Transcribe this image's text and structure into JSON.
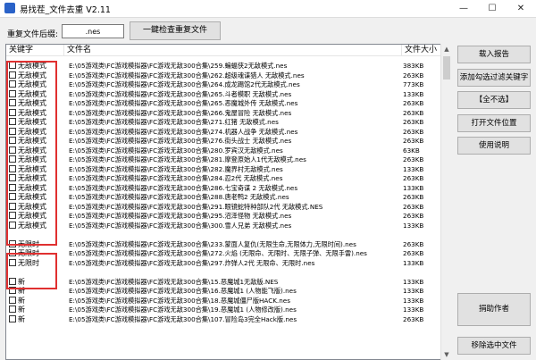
{
  "window": {
    "title": "易找茬_文件去重 V2.11",
    "minimize_glyph": "—",
    "maximize_glyph": "☐",
    "close_glyph": "✕"
  },
  "ext": {
    "label": "重复文件后缀:",
    "value": ".nes"
  },
  "check_button": "一鍵检查重复文件",
  "columns": {
    "keyword": "关键字",
    "filename": "文件名",
    "size": "文件大小"
  },
  "rows": [
    {
      "kw": "无敌模式",
      "file": "E:\\05游戏类\\FC游戏模拟器\\FC游戏无敌300合集\\259.蝙蝠侠2无敌模式.nes",
      "size": "383KB"
    },
    {
      "kw": "无敌模式",
      "file": "E:\\05游戏类\\FC游戏模拟器\\FC游戏无敌300合集\\262.超级魂谍猎人 无敌模式.nes",
      "size": "263KB"
    },
    {
      "kw": "无敌模式",
      "file": "E:\\05游戏类\\FC游戏模拟器\\FC游戏无敌300合集\\264.成龙踢馆2代无敌模式.nes",
      "size": "773KB"
    },
    {
      "kw": "无敌模式",
      "file": "E:\\05游戏类\\FC游戏模拟器\\FC游戏无敌300合集\\265.斗者模职 无敌模式.nes",
      "size": "133KB"
    },
    {
      "kw": "无敌模式",
      "file": "E:\\05游戏类\\FC游戏模拟器\\FC游戏无敌300合集\\265.恶魔城外传 无敌模式.nes",
      "size": "263KB"
    },
    {
      "kw": "无敌模式",
      "file": "E:\\05游戏类\\FC游戏模拟器\\FC游戏无敌300合集\\266.鬼屋冒险 无敌模式.nes",
      "size": "263KB"
    },
    {
      "kw": "无敌模式",
      "file": "E:\\05游戏类\\FC游戏模拟器\\FC游戏无敌300合集\\271.红猪 无敌模式.nes",
      "size": "263KB"
    },
    {
      "kw": "无敌模式",
      "file": "E:\\05游戏类\\FC游戏模拟器\\FC游戏无敌300合集\\274.机器人战争 无敌模式.nes",
      "size": "263KB"
    },
    {
      "kw": "无敌模式",
      "file": "E:\\05游戏类\\FC游戏模拟器\\FC游戏无敌300合集\\276.街头战士 无敌模式.nes",
      "size": "263KB"
    },
    {
      "kw": "无敌模式",
      "file": "E:\\05游戏类\\FC游戏模拟器\\FC游戏无敌300合集\\280.罗宾汉无敌模式.nes",
      "size": "63KB"
    },
    {
      "kw": "无敌模式",
      "file": "E:\\05游戏类\\FC游戏模拟器\\FC游戏无敌300合集\\281.摩登原始人1代无敌模式.nes",
      "size": "263KB"
    },
    {
      "kw": "无敌模式",
      "file": "E:\\05游戏类\\FC游戏模拟器\\FC游戏无敌300合集\\282.魔界村无敌模式.nes",
      "size": "133KB"
    },
    {
      "kw": "无敌模式",
      "file": "E:\\05游戏类\\FC游戏模拟器\\FC游戏无敌300合集\\284.忍2代 无敌模式.nes",
      "size": "263KB"
    },
    {
      "kw": "无敌模式",
      "file": "E:\\05游戏类\\FC游戏模拟器\\FC游戏无敌300合集\\286.七宝奇谋 2 无敌模式.nes",
      "size": "133KB"
    },
    {
      "kw": "无敌模式",
      "file": "E:\\05游戏类\\FC游戏模拟器\\FC游戏无敌300合集\\288.唐老鸭2 无敌模式.nes",
      "size": "263KB"
    },
    {
      "kw": "无敌模式",
      "file": "E:\\05游戏类\\FC游戏模拟器\\FC游戏无敌300合集\\291.眼镜蛇特种部队2代 无敌模式.NES",
      "size": "263KB"
    },
    {
      "kw": "无敌模式",
      "file": "E:\\05游戏类\\FC游戏模拟器\\FC游戏无敌300合集\\295.沼泽怪物 无敌模式.nes",
      "size": "263KB"
    },
    {
      "kw": "无敌模式",
      "file": "E:\\05游戏类\\FC游戏模拟器\\FC游戏无敌300合集\\300.雪人兄弟 无敌模式.nes",
      "size": "133KB"
    },
    {
      "kw": "",
      "file": "",
      "size": ""
    },
    {
      "kw": "无限时",
      "file": "E:\\05游戏类\\FC游戏模拟器\\FC游戏无敌300合集\\233.蒙面人复仇(无限生命,无限体力,无限时间).nes",
      "size": "263KB"
    },
    {
      "kw": "无限时",
      "file": "E:\\05游戏类\\FC游戏模拟器\\FC游戏无敌300合集\\272.火焰 (无限命、无限时、无限子弹、无限手雷).nes",
      "size": "263KB"
    },
    {
      "kw": "无限时",
      "file": "E:\\05游戏类\\FC游戏模拟器\\FC游戏无敌300合集\\297.炸弹人2代 无限命、无限时.nes",
      "size": "133KB"
    },
    {
      "kw": "",
      "file": "",
      "size": ""
    },
    {
      "kw": "新",
      "file": "E:\\05游戏类\\FC游戏模拟器\\FC游戏无敌300合集\\15.恶魔城1无敌版.NES",
      "size": "133KB"
    },
    {
      "kw": "新",
      "file": "E:\\05游戏类\\FC游戏模拟器\\FC游戏无敌300合集\\16.恶魔城1 (人物能飞版).nes",
      "size": "133KB"
    },
    {
      "kw": "新",
      "file": "E:\\05游戏类\\FC游戏模拟器\\FC游戏无敌300合集\\18.恶魔城僵尸版HACK.nes",
      "size": "133KB"
    },
    {
      "kw": "新",
      "file": "E:\\05游戏类\\FC游戏模拟器\\FC游戏无敌300合集\\19.恶魔城1 (人物修改版).nes",
      "size": "133KB"
    },
    {
      "kw": "新",
      "file": "E:\\05游戏类\\FC游戏模拟器\\FC游戏无敌300合集\\107.冒险岛3完全Hack版.nes",
      "size": "263KB"
    }
  ],
  "buttons": {
    "load_report": "载入报告",
    "add_filter": "添加勾选过滤关键字",
    "deselect_all": "【全不选】",
    "open_location": "打开文件位置",
    "usage": "使用说明",
    "donate": "捐助作者",
    "remove_selected": "移除选中文件"
  },
  "colors": {
    "highlight_box": "#e03030"
  },
  "icons": {
    "scroll_up": "▲",
    "scroll_down": "▼"
  }
}
